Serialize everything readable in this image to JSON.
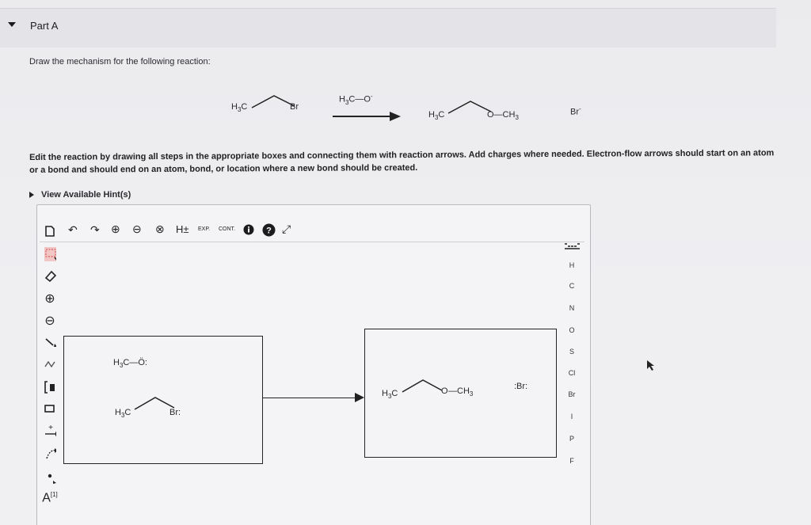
{
  "part": {
    "title": "Part A",
    "intro": "Draw the mechanism for the following reaction:"
  },
  "reaction": {
    "reactant_c": "H3C",
    "reactant_br": "Br",
    "reagent": "H3C—O",
    "reagent_charge": "-",
    "product_c": "H3C",
    "product_o": "O—CH3",
    "byproduct": "Br",
    "byproduct_charge": "-"
  },
  "instructions": "Edit the reaction by drawing all steps in the appropriate boxes and connecting them with reaction arrows. Add charges where needed. Electron-flow arrows should start on an atom or a bond and should end on an atom, bond, or location where a new bond should be created.",
  "hints_label": "View Available Hint(s)",
  "toolbar": {
    "hplus": "H±",
    "exp": "EXP.",
    "cont": "CONT."
  },
  "side_toolbar": {
    "charge_plus": "+",
    "charge_minus": "−",
    "bracket_label": "[1]",
    "atom_label": "A"
  },
  "periodic": [
    "H",
    "C",
    "N",
    "O",
    "S",
    "Cl",
    "Br",
    "I",
    "P",
    "F"
  ],
  "box1": {
    "methoxide_c": "H3C—",
    "methoxide_o": "O:",
    "bromide_c": "H3C",
    "bromide_br": "Br:"
  },
  "box2": {
    "product_c": "H3C",
    "product_o": "O",
    "product_ch3": "—CH3",
    "br_ion": ":Br:"
  }
}
